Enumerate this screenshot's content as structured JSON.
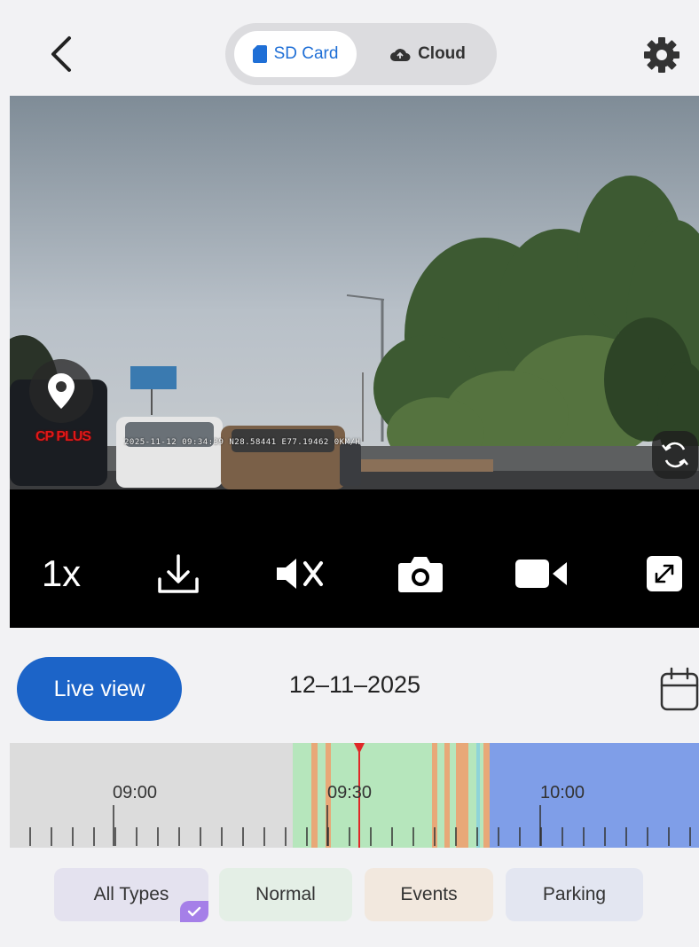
{
  "header": {
    "tabs": [
      {
        "label": "SD Card",
        "icon": "sd-card-icon",
        "selected": true
      },
      {
        "label": "Cloud",
        "icon": "cloud-icon",
        "selected": false
      }
    ],
    "accent_color": "#1f6fd6"
  },
  "video": {
    "brand": "CP PLUS",
    "overlay": "2025-11-12 09:34:39  N28.58441 E77.19462  0KM/H"
  },
  "controls": {
    "speed_label": "1x",
    "icons": [
      "download-icon",
      "mute-icon",
      "camera-icon",
      "video-record-icon",
      "fullscreen-icon"
    ]
  },
  "date_row": {
    "live_label": "Live view",
    "date": "12–11–2025",
    "live_color": "#1c64c8"
  },
  "timeline": {
    "labels": [
      "09:00",
      "09:30",
      "10:00"
    ],
    "colors": {
      "normal": "#b6e6bc",
      "event": "#e8a878",
      "parking": "#7f9ee8",
      "empty": "#dcdcdc",
      "cursor": "#e02828"
    }
  },
  "filters": [
    {
      "label": "All Types",
      "selected": true
    },
    {
      "label": "Normal",
      "selected": false
    },
    {
      "label": "Events",
      "selected": false
    },
    {
      "label": "Parking",
      "selected": false
    }
  ]
}
